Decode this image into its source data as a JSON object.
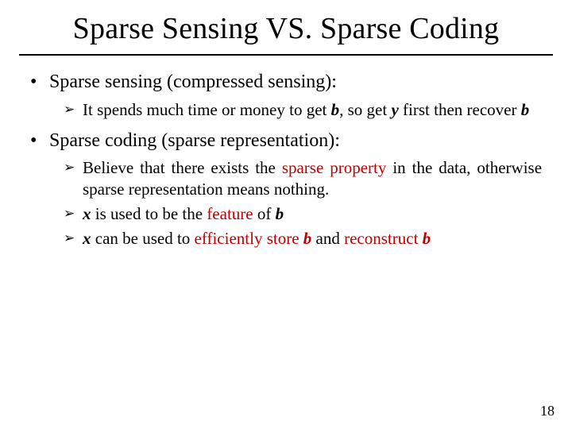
{
  "title": "Sparse Sensing VS. Sparse Coding",
  "bullet1": {
    "heading": "Sparse sensing (compressed sensing):",
    "sub1": {
      "t1": "It spends much time or money to get ",
      "b": "b",
      "t2": ", so get ",
      "y": "y",
      "t3": " first then recover ",
      "b2": "b"
    }
  },
  "bullet2": {
    "heading": "Sparse coding (sparse representation):",
    "sub1": {
      "t1": "Believe that there exists the ",
      "sp": "sparse property",
      "t2": " in the data, otherwise sparse representation means nothing."
    },
    "sub2": {
      "x": "x",
      "t1": " is used to be the ",
      "feat": "feature",
      "t2": " of ",
      "b": "b"
    },
    "sub3": {
      "x": "x",
      "t1": " can be used to ",
      "eff": "efficiently store ",
      "b": "b",
      "t2": " and ",
      "rec": "reconstruct ",
      "b2": "b"
    }
  },
  "arrow": "➢",
  "page": "18"
}
